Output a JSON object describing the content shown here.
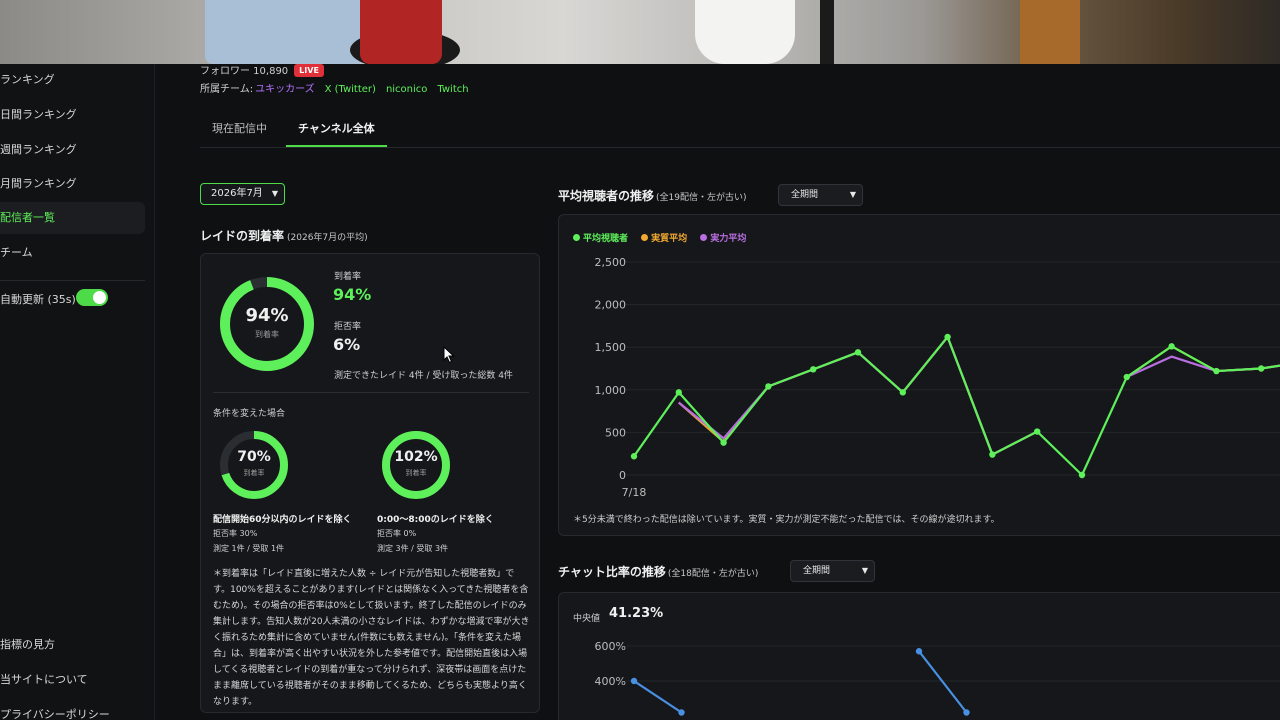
{
  "sidebar": {
    "items": [
      {
        "label": "ランキング",
        "active": false
      },
      {
        "label": "日間ランキング",
        "active": false
      },
      {
        "label": "週間ランキング",
        "active": false
      },
      {
        "label": "月間ランキング",
        "active": false
      },
      {
        "label": "配信者一覧",
        "active": true
      },
      {
        "label": "チーム",
        "active": false
      }
    ],
    "auto_refresh_label": "自動更新 (35s)",
    "auto_refresh_on": true,
    "footer_items": [
      {
        "label": "指標の見方"
      },
      {
        "label": "当サイトについて"
      },
      {
        "label": "プライバシーポリシー"
      }
    ]
  },
  "header": {
    "followers_text": "フォロワー 10,890",
    "live_badge": "LIVE",
    "team_label": "所属チーム:",
    "team_name": "ユキッカーズ",
    "links": [
      "X (Twitter)",
      "niconico",
      "Twitch"
    ]
  },
  "tabs": [
    {
      "label": "現在配信中",
      "active": false
    },
    {
      "label": "チャンネル全体",
      "active": true
    }
  ],
  "month_select": {
    "value": "2026年7月"
  },
  "raid": {
    "title": "レイドの到着率",
    "subtitle": "(2026年7月の平均)",
    "main_ring": {
      "value": "94%",
      "sub": "到着率",
      "fraction": 0.94
    },
    "arrival_label": "到着率",
    "arrival_value": "94%",
    "reject_label": "拒否率",
    "reject_value": "6%",
    "measured_note": "測定できたレイド 4件 / 受け取った総数 4件",
    "conditions_title": "条件を変えた場合",
    "conditions": [
      {
        "ring_value": "70%",
        "ring_sub": "到着率",
        "fraction": 0.7,
        "label": "配信開始60分以内のレイドを除く",
        "reject": "拒否率 30%",
        "measured": "測定 1件 / 受取 1件"
      },
      {
        "ring_value": "102%",
        "ring_sub": "到着率",
        "fraction": 1.0,
        "label": "0:00〜8:00のレイドを除く",
        "reject": "拒否率 0%",
        "measured": "測定 3件 / 受取 3件"
      }
    ],
    "note": "＊到着率は「レイド直後に増えた人数 ÷ レイド元が告知した視聴者数」です。100%を超えることがあります(レイドとは関係なく入ってきた視聴者を含むため)。その場合の拒否率は0%として扱います。終了した配信のレイドのみ集計します。告知人数が20人未満の小さなレイドは、わずかな増減で率が大きく振れるため集計に含めていません(件数にも数えません)。「条件を変えた場合」は、到着率が高く出やすい状況を外した参考値です。配信開始直後は入場してくる視聴者とレイドの到着が重なって分けられず、深夜帯は画面を点けたまま離席している視聴者がそのまま移動してくるため、どちらも実態より高くなります。"
  },
  "avg_chart": {
    "title": "平均視聴者の推移",
    "subtitle": "(全19配信・左が古い)",
    "period_select": "全期間",
    "legend": [
      {
        "name": "平均視聴者",
        "color": "#5ef05a"
      },
      {
        "name": "実質平均",
        "color": "#f0a830"
      },
      {
        "name": "実力平均",
        "color": "#b86ee0"
      }
    ],
    "note": "＊5分未満で終わった配信は除いています。実質・実力が測定不能だった配信では、その線が途切れます。"
  },
  "chat_chart": {
    "title": "チャット比率の推移",
    "subtitle": "(全18配信・左が古い)",
    "period_select": "全期間",
    "median_label": "中央値",
    "median_value": "41.23%"
  },
  "chart_data": [
    {
      "type": "line",
      "title": "平均視聴者の推移",
      "xlabel": "",
      "ylabel": "",
      "ylim": [
        0,
        2500
      ],
      "yticks": [
        "0",
        "500",
        "1,000",
        "1,500",
        "2,000",
        "2,500"
      ],
      "x_first_label": "7/18",
      "grid": true,
      "legend": "top-left",
      "series": [
        {
          "name": "平均視聴者",
          "color": "#5ef05a",
          "values": [
            220,
            970,
            380,
            1040,
            1240,
            1440,
            970,
            1620,
            240,
            510,
            0,
            1150,
            1510,
            1220,
            1250,
            1330
          ]
        },
        {
          "name": "実質平均",
          "color": "#f0a830",
          "values": [
            null,
            850,
            390,
            1040,
            1240,
            1440,
            970,
            1620,
            240,
            510,
            null,
            1150,
            1510,
            1220,
            1250,
            1330
          ]
        },
        {
          "name": "実力平均",
          "color": "#b86ee0",
          "values": [
            null,
            850,
            430,
            1040,
            1240,
            1440,
            970,
            1620,
            240,
            510,
            null,
            1150,
            1390,
            1220,
            1250,
            1330
          ]
        }
      ]
    },
    {
      "type": "line",
      "title": "チャット比率の推移",
      "ylim": [
        0,
        600
      ],
      "yticks": [
        "400%",
        "600%"
      ],
      "series": [
        {
          "name": "",
          "color": "#4a90e2",
          "values": [
            400,
            220,
            null,
            null,
            null,
            null,
            570,
            220
          ]
        }
      ]
    }
  ]
}
